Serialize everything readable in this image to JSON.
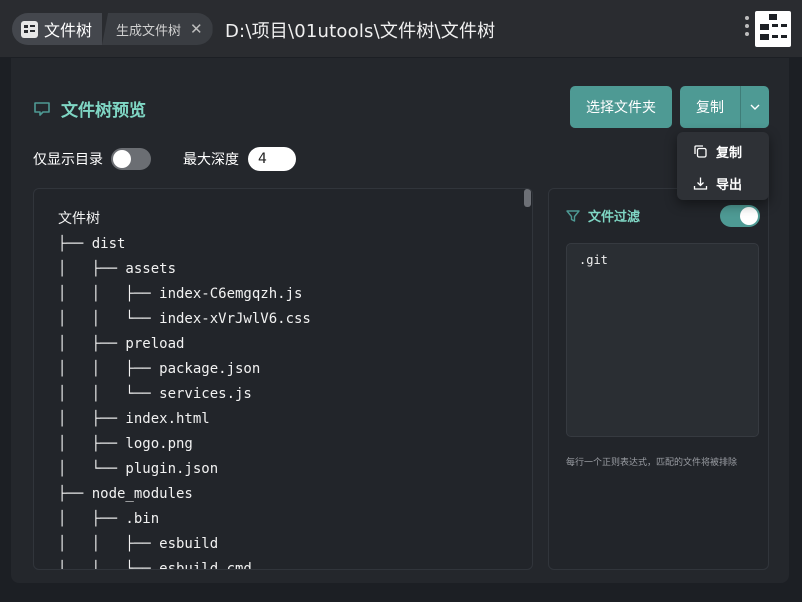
{
  "window": {
    "app_tab_label": "文件树",
    "sub_tab_label": "生成文件树",
    "close_symbol": "✕",
    "path_title": "D:\\项目\\01utools\\文件树\\文件树"
  },
  "header": {
    "title": "文件树预览",
    "choose_folder_label": "选择文件夹",
    "copy_label": "复制"
  },
  "options": {
    "dirs_only_label": "仅显示目录",
    "dirs_only_on": false,
    "max_depth_label": "最大深度",
    "max_depth_value": "4"
  },
  "tree": {
    "lines": [
      "文件树",
      "├── dist",
      "│   ├── assets",
      "│   │   ├── index-C6emgqzh.js",
      "│   │   └── index-xVrJwlV6.css",
      "│   ├── preload",
      "│   │   ├── package.json",
      "│   │   └── services.js",
      "│   ├── index.html",
      "│   ├── logo.png",
      "│   └── plugin.json",
      "├── node_modules",
      "│   ├── .bin",
      "│   │   ├── esbuild",
      "│   │   └── esbuild.cmd"
    ]
  },
  "filter": {
    "title": "文件过滤",
    "enabled": true,
    "patterns": ".git",
    "hint": "每行一个正则表达式，匹配的文件将被排除"
  },
  "dropdown": {
    "items": [
      {
        "label": "复制",
        "icon": "copy-icon"
      },
      {
        "label": "导出",
        "icon": "download-icon"
      }
    ]
  },
  "colors": {
    "accent": "#4e9a94",
    "accent_text": "#7fd6c4",
    "background": "#1c1f24",
    "panel": "#24272c"
  }
}
